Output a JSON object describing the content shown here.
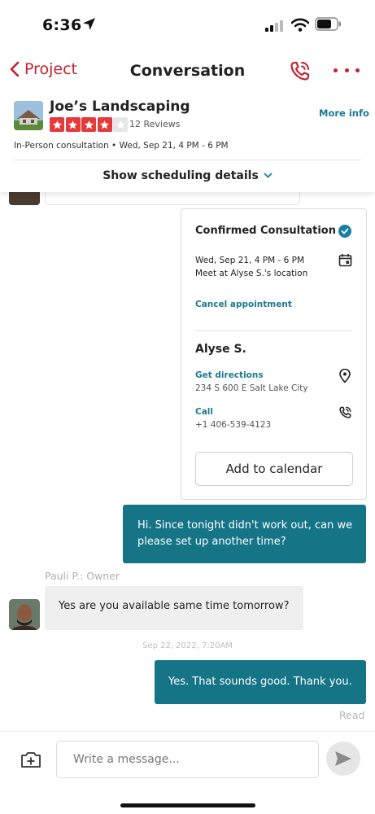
{
  "status_bar": {
    "time": "6:36"
  },
  "nav": {
    "back_label": "Project",
    "title": "Conversation"
  },
  "business": {
    "name": "Joe’s Landscaping",
    "rating": 4,
    "rating_max": 5,
    "reviews": "12 Reviews",
    "more_info": "More info",
    "meta": "In-Person consultation • Wed, Sep 21, 4 PM - 6 PM",
    "scheduling_toggle": "Show scheduling details"
  },
  "card": {
    "title": "Confirmed Consultation",
    "date": "Wed, Sep 21, 4 PM - 6 PM",
    "location": "Meet at Alyse S.'s location",
    "cancel": "Cancel appointment",
    "person": "Alyse S.",
    "directions_label": "Get directions",
    "address": "234 S 600 E Salt Lake City",
    "call_label": "Call",
    "phone": "+1 406-539-4123",
    "add_calendar": "Add to calendar"
  },
  "messages": [
    {
      "text": "Hi. Since tonight didn't work out, can we please set up another time?"
    },
    {
      "sender": "Pauli P.: Owner",
      "text": "Yes are you available same time tomorrow?"
    },
    {
      "timestamp": "Sep 22, 2022, 7:20AM"
    },
    {
      "text": "Yes. That sounds good. Thank you.",
      "status": "Read"
    }
  ],
  "composer": {
    "placeholder": "Write a message..."
  },
  "colors": {
    "brand_red": "#c8202e",
    "teal": "#167487",
    "link": "#1a7a8f"
  }
}
